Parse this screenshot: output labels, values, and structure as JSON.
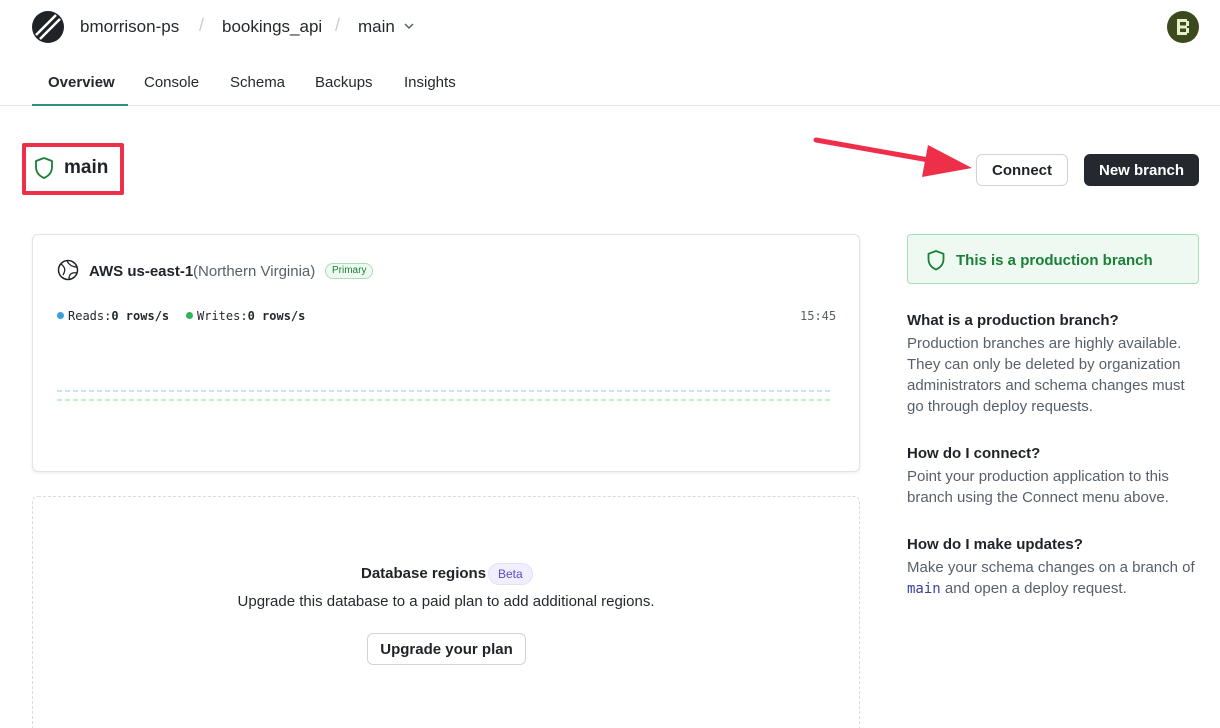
{
  "header": {
    "org": "bmorrison-ps",
    "database": "bookings_api",
    "branch": "main",
    "separator": "/"
  },
  "tabs": [
    {
      "label": "Overview",
      "active": true
    },
    {
      "label": "Console"
    },
    {
      "label": "Schema"
    },
    {
      "label": "Backups"
    },
    {
      "label": "Insights"
    }
  ],
  "branch": {
    "title": "main",
    "connect_label": "Connect",
    "new_branch_label": "New branch"
  },
  "region": {
    "name": "AWS us-east-1",
    "location": "(Northern Virginia)",
    "badge": "Primary",
    "reads_label": "Reads:",
    "reads_value": "0 rows/s",
    "writes_label": "Writes:",
    "writes_value": "0 rows/s",
    "time": "15:45",
    "colors": {
      "reads": "#3aa0dc",
      "writes": "#2fb45a"
    }
  },
  "regions_upsell": {
    "title": "Database regions",
    "badge": "Beta",
    "description": "Upgrade this database to a paid plan to add additional regions.",
    "button_label": "Upgrade your plan"
  },
  "sidebar": {
    "banner": "This is a production branch",
    "faq": [
      {
        "q": "What is a production branch?",
        "a": [
          "Production branches are highly available.",
          "They can only be deleted by organization",
          "administrators and schema changes must",
          "go through deploy requests."
        ]
      },
      {
        "q": "How do I connect?",
        "a": [
          "Point your production application to this",
          "branch using the Connect menu above."
        ]
      },
      {
        "q": "How do I make updates?",
        "a": [
          "Make your schema changes on a branch of"
        ],
        "code": "main",
        "a_tail": " and open a deploy request."
      }
    ]
  },
  "colors": {
    "accent": "#2f8f83",
    "highlight": "#ee2f4a",
    "success": "#1a7f37"
  }
}
